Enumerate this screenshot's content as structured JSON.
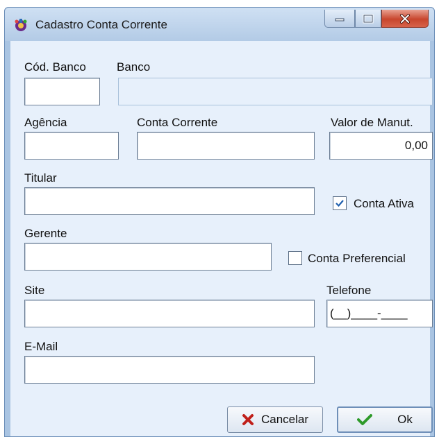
{
  "window": {
    "title": "Cadastro Conta Corrente",
    "icon": "app-icon",
    "controls": [
      "minimize-icon",
      "maximize-icon",
      "close-icon"
    ]
  },
  "form": {
    "cod_banco": {
      "label": "Cód. Banco",
      "value": ""
    },
    "banco": {
      "label": "Banco",
      "value": ""
    },
    "agencia": {
      "label": "Agência",
      "value": ""
    },
    "conta_corrente": {
      "label": "Conta Corrente",
      "value": ""
    },
    "valor_manut": {
      "label": "Valor de Manut.",
      "value": "0,00"
    },
    "titular": {
      "label": "Titular",
      "value": ""
    },
    "conta_ativa": {
      "label": "Conta Ativa",
      "checked": true
    },
    "gerente": {
      "label": "Gerente",
      "value": ""
    },
    "conta_preferencial": {
      "label": "Conta Preferencial",
      "checked": false
    },
    "site": {
      "label": "Site",
      "value": ""
    },
    "telefone": {
      "label": "Telefone",
      "value": "(__)____-____"
    },
    "email": {
      "label": "E-Mail",
      "value": ""
    }
  },
  "buttons": {
    "cancelar": "Cancelar",
    "ok": "Ok"
  },
  "colors": {
    "frame": "#a9c4e2",
    "client": "#e7f0fb",
    "close": "#c8462d",
    "check": "#1f5fae",
    "cancel_x": "#c0201a",
    "ok_check": "#2e9a2a"
  }
}
